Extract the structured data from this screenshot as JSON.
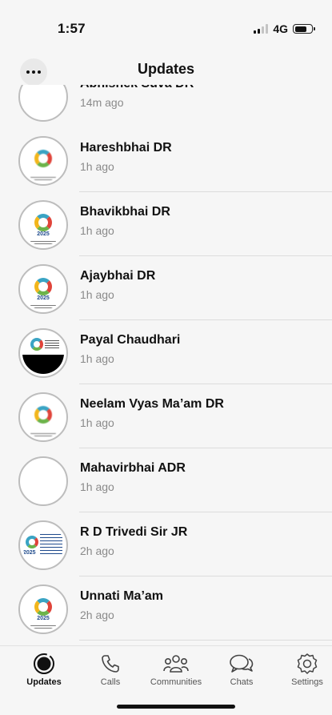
{
  "status": {
    "time": "1:57",
    "network": "4G"
  },
  "header": {
    "title": "Updates"
  },
  "updates": [
    {
      "name": "Abhishek Suva DR",
      "time": "14m ago",
      "thumb": "doc"
    },
    {
      "name": "Hareshbhai DR",
      "time": "1h ago",
      "thumb": "blur"
    },
    {
      "name": "Bhavikbhai DR",
      "time": "1h ago",
      "thumb": "logo"
    },
    {
      "name": "Ajaybhai DR",
      "time": "1h ago",
      "thumb": "logo"
    },
    {
      "name": "Payal Chaudhari",
      "time": "1h ago",
      "thumb": "black"
    },
    {
      "name": "Neelam Vyas Ma’am DR",
      "time": "1h ago",
      "thumb": "blur"
    },
    {
      "name": "Mahavirbhai ADR",
      "time": "1h ago",
      "thumb": "doc"
    },
    {
      "name": "R D Trivedi Sir JR",
      "time": "2h ago",
      "thumb": "side"
    },
    {
      "name": "Unnati Ma’am",
      "time": "2h ago",
      "thumb": "logo"
    }
  ],
  "tabs": [
    {
      "label": "Updates",
      "icon": "updates-icon",
      "active": true
    },
    {
      "label": "Calls",
      "icon": "phone-icon"
    },
    {
      "label": "Communities",
      "icon": "communities-icon"
    },
    {
      "label": "Chats",
      "icon": "chats-icon"
    },
    {
      "label": "Settings",
      "icon": "settings-icon"
    }
  ],
  "colors": {
    "accent": "#111111",
    "divider": "#dcdcdc",
    "time_text": "#8a8a8a"
  }
}
